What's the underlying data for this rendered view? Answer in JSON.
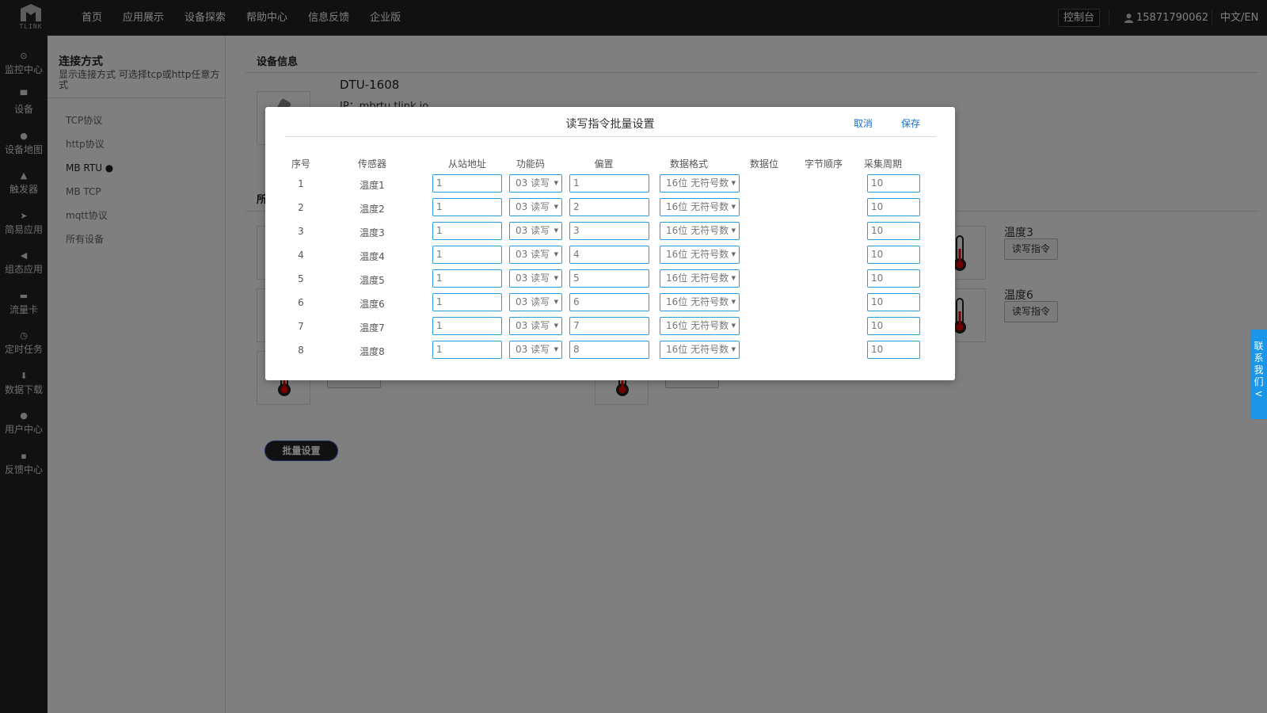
{
  "header": {
    "logo_text": "TLINK",
    "nav": [
      "首页",
      "应用展示",
      "设备探索",
      "帮助中心",
      "信息反馈",
      "企业版"
    ],
    "console": "控制台",
    "user_phone": "15871790062",
    "lang": "中文/EN"
  },
  "sidebar": {
    "items": [
      {
        "label": "监控中心",
        "icon": "monitor-icon"
      },
      {
        "label": "设备",
        "icon": "device-icon"
      },
      {
        "label": "设备地图",
        "icon": "map-pin-icon"
      },
      {
        "label": "触发器",
        "icon": "bell-icon"
      },
      {
        "label": "简易应用",
        "icon": "send-icon"
      },
      {
        "label": "组态应用",
        "icon": "share-icon"
      },
      {
        "label": "流量卡",
        "icon": "card-icon"
      },
      {
        "label": "定时任务",
        "icon": "clock-icon"
      },
      {
        "label": "数据下载",
        "icon": "download-icon"
      },
      {
        "label": "用户中心",
        "icon": "user-icon"
      },
      {
        "label": "反馈中心",
        "icon": "comment-icon"
      }
    ]
  },
  "subnav": {
    "title": "连接方式",
    "desc": "显示连接方式 可选择tcp或http任意方式",
    "items": [
      "TCP协议",
      "http协议",
      "MB RTU ●",
      "MB TCP",
      "mqtt协议",
      "所有设备"
    ],
    "active_index": 2
  },
  "main": {
    "device_info_title": "设备信息",
    "device_name": "DTU-1608",
    "device_ip": "IP：mbrtu.tlink.io",
    "sensors_title_partial": "所",
    "sensor_cards": [
      {
        "label": "温度3",
        "button": "读写指令"
      },
      {
        "label": "温度6",
        "button": "读写指令"
      }
    ],
    "batch_button": "批量设置"
  },
  "modal": {
    "title": "读写指令批量设置",
    "cancel": "取消",
    "save": "保存",
    "headers": [
      "序号",
      "传感器",
      "从站地址",
      "功能码",
      "偏置",
      "数据格式",
      "数据位",
      "字节顺序",
      "采集周期"
    ],
    "rows": [
      {
        "no": "1",
        "sensor": "温度1",
        "slave": "1",
        "func": "03 读写",
        "offset": "1",
        "format": "16位 无符号数",
        "period": "10"
      },
      {
        "no": "2",
        "sensor": "温度2",
        "slave": "1",
        "func": "03 读写",
        "offset": "2",
        "format": "16位 无符号数",
        "period": "10"
      },
      {
        "no": "3",
        "sensor": "温度3",
        "slave": "1",
        "func": "03 读写",
        "offset": "3",
        "format": "16位 无符号数",
        "period": "10"
      },
      {
        "no": "4",
        "sensor": "温度4",
        "slave": "1",
        "func": "03 读写",
        "offset": "4",
        "format": "16位 无符号数",
        "period": "10"
      },
      {
        "no": "5",
        "sensor": "温度5",
        "slave": "1",
        "func": "03 读写",
        "offset": "5",
        "format": "16位 无符号数",
        "period": "10"
      },
      {
        "no": "6",
        "sensor": "温度6",
        "slave": "1",
        "func": "03 读写",
        "offset": "6",
        "format": "16位 无符号数",
        "period": "10"
      },
      {
        "no": "7",
        "sensor": "温度7",
        "slave": "1",
        "func": "03 读写",
        "offset": "7",
        "format": "16位 无符号数",
        "period": "10"
      },
      {
        "no": "8",
        "sensor": "温度8",
        "slave": "1",
        "func": "03 读写",
        "offset": "8",
        "format": "16位 无符号数",
        "period": "10"
      }
    ]
  },
  "contact": "联系我们 <",
  "colors": {
    "topbar": "#222222",
    "accent": "#1a95e8",
    "input_border": "#2a9be0",
    "link": "#1a6ec5"
  }
}
